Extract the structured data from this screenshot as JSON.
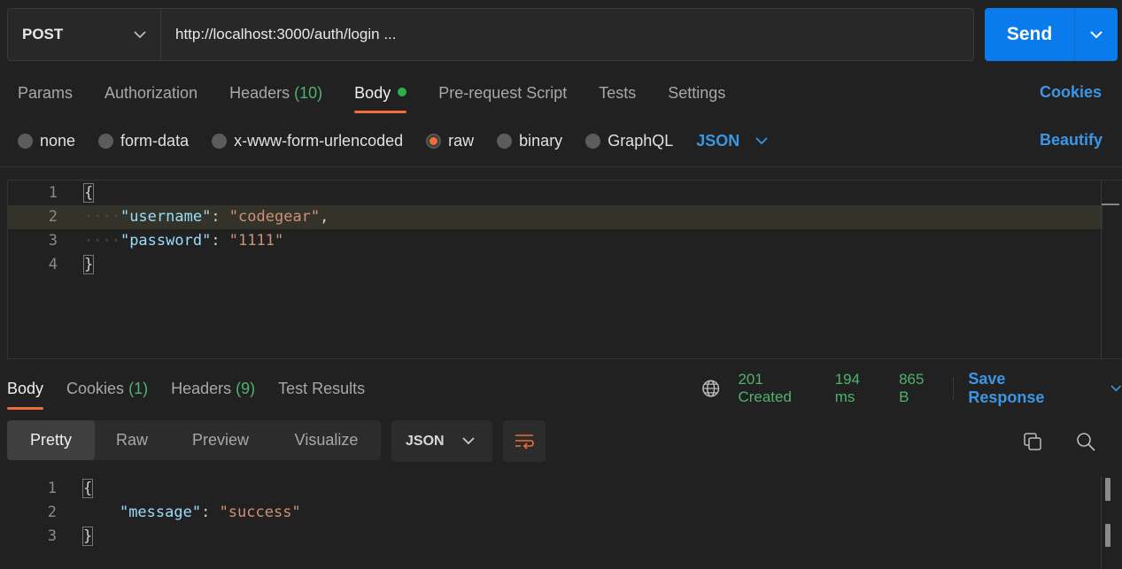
{
  "request": {
    "method": "POST",
    "url": "http://localhost:3000/auth/login ...",
    "send_label": "Send"
  },
  "request_tabs": {
    "params": "Params",
    "authorization": "Authorization",
    "headers": "Headers",
    "headers_count": "(10)",
    "body": "Body",
    "prerequest": "Pre-request Script",
    "tests": "Tests",
    "settings": "Settings",
    "cookies": "Cookies"
  },
  "body_types": {
    "none": "none",
    "form_data": "form-data",
    "urlencoded": "x-www-form-urlencoded",
    "raw": "raw",
    "binary": "binary",
    "graphql": "GraphQL",
    "format": "JSON",
    "selected": "raw",
    "beautify": "Beautify"
  },
  "request_body": {
    "line_numbers": [
      "1",
      "2",
      "3",
      "4"
    ],
    "open_brace": "{",
    "close_brace": "}",
    "key1": "\"username\"",
    "val1": "\"codegear\"",
    "key2": "\"password\"",
    "val2": "\"1111\""
  },
  "response_tabs": {
    "body": "Body",
    "cookies": "Cookies",
    "cookies_count": "(1)",
    "headers": "Headers",
    "headers_count": "(9)",
    "test_results": "Test Results"
  },
  "response_status": {
    "status": "201 Created",
    "time": "194 ms",
    "size": "865 B",
    "save_response": "Save Response"
  },
  "response_view": {
    "pretty": "Pretty",
    "raw": "Raw",
    "preview": "Preview",
    "visualize": "Visualize",
    "format": "JSON"
  },
  "response_body": {
    "line_numbers": [
      "1",
      "2",
      "3"
    ],
    "open_brace": "{",
    "close_brace": "}",
    "key1": "\"message\"",
    "val1": "\"success\""
  },
  "colors": {
    "accent": "#f26b3a",
    "link_blue": "#3b97e3",
    "send_blue": "#097bed",
    "status_green": "#4fb36e"
  }
}
